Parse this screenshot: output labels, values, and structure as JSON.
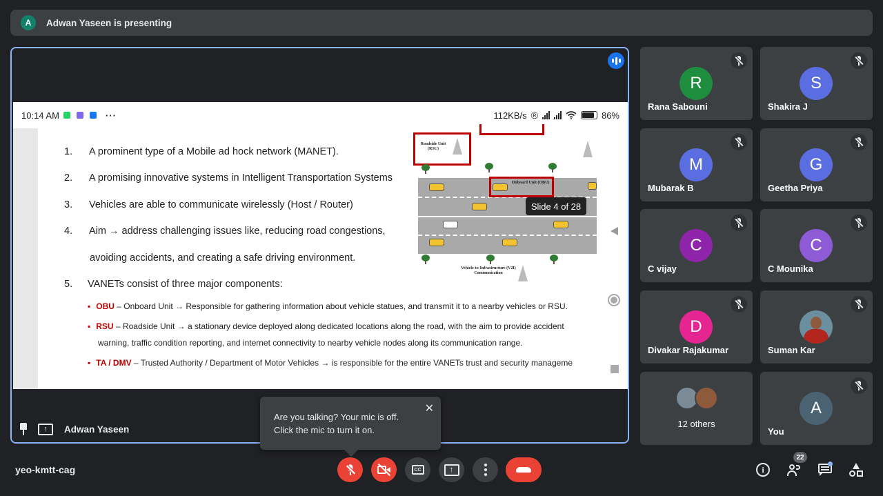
{
  "presenting_bar": {
    "avatar_letter": "A",
    "text": "Adwan Yaseen is presenting",
    "avatar_color": "#12826a"
  },
  "share": {
    "status": {
      "time": "10:14 AM",
      "more": "···",
      "speed": "112KB/s",
      "reg": "®",
      "battery": "86%"
    },
    "slide": {
      "items": [
        {
          "num": "1.",
          "text": "A prominent type of a Mobile ad hock network (MANET)."
        },
        {
          "num": "2.",
          "text": "A promising innovative systems in Intelligent Transportation Systems"
        },
        {
          "num": "3.",
          "text": "Vehicles  are able to communicate wirelessly (Host / Router)"
        },
        {
          "num": "4.",
          "text": "Aim → address challenging issues like, reducing road congestions,"
        },
        {
          "num": "",
          "text": "avoiding accidents, and creating a safe driving environment."
        },
        {
          "num": "5.",
          "text": "VANETs consist of three major components:"
        }
      ],
      "sub_items": [
        {
          "abbr": "OBU",
          "rest": " – Onboard Unit → Responsible for gathering information about vehicle statues, and transmit it to a nearby vehicles or RSU."
        },
        {
          "abbr": "RSU",
          "rest": " – Roadside Unit → a stationary device deployed along dedicated locations along the road, with the aim to provide accident"
        },
        {
          "abbr": "",
          "rest": "warning, traffic condition reporting, and internet connectivity to nearby vehicle nodes along its communication range."
        },
        {
          "abbr": "TA / DMV",
          "rest": " – Trusted Authority / Department of Motor Vehicles → is responsible for the entire VANETs trust and security managemе"
        }
      ],
      "diagram": {
        "rsu_label": "Roadside Unit (RSU)",
        "obu_label": "Onboard Unit (OBU)",
        "v2i_label": "Vehicle-to-Infrastructure (V2I) Communication",
        "road_color": "#a9a9a9",
        "highlight_color": "#c00000"
      }
    },
    "tooltip": "Slide 4 of 28"
  },
  "stage": {
    "presenter_name": "Adwan Yaseen",
    "border_color": "#8ab4f8"
  },
  "toast": {
    "line1": "Are you talking? Your mic is off.",
    "line2": "Click the mic to turn it on.",
    "close": "✕"
  },
  "participants": [
    {
      "name": "Rana Sabouni",
      "letter": "R",
      "color": "#1e8e3e"
    },
    {
      "name": "Shakira J",
      "letter": "S",
      "color": "#5b6ee1"
    },
    {
      "name": "Mubarak B",
      "letter": "M",
      "color": "#5b6ee1"
    },
    {
      "name": "Geetha Priya",
      "letter": "G",
      "color": "#5b6ee1"
    },
    {
      "name": "C vijay",
      "letter": "C",
      "color": "#8e24aa"
    },
    {
      "name": "C Mounika",
      "letter": "C",
      "color": "#8e5bd6"
    },
    {
      "name": "Divakar Rajakumar",
      "letter": "D",
      "color": "#e52592"
    },
    {
      "name": "Suman Kar",
      "letter": "",
      "color": "#6b8f9e"
    },
    {
      "name": "12 others",
      "letter": "",
      "color": "#3c4043"
    },
    {
      "name": "You",
      "letter": "A",
      "color": "#4a6272"
    }
  ],
  "bottom": {
    "meeting_code": "yeo-kmtt-cag",
    "people_count": "22",
    "cc": "CC",
    "danger_color": "#ea4335"
  }
}
